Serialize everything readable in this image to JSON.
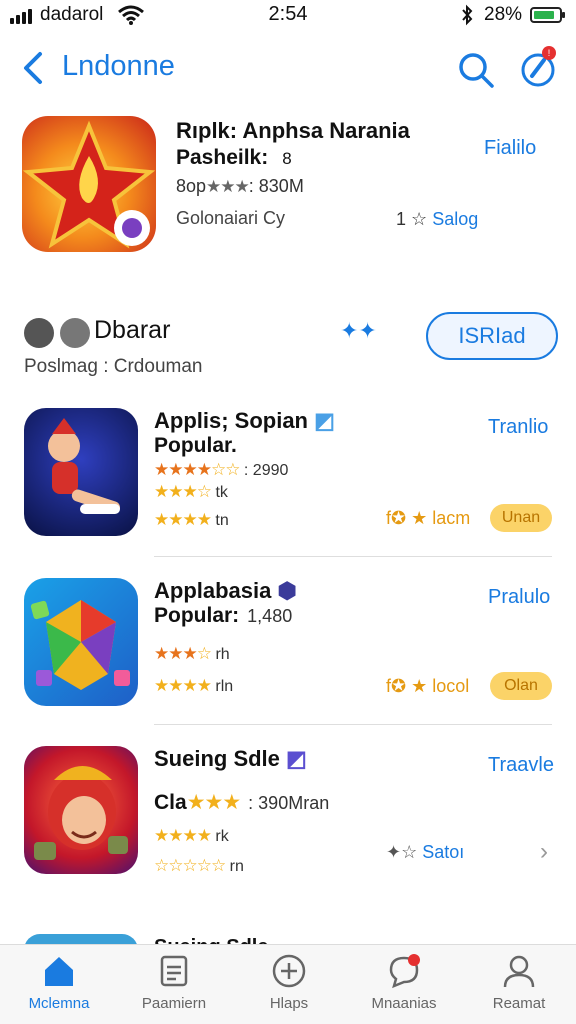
{
  "status_bar": {
    "carrier": "dadarol",
    "time": "2:54",
    "battery": "28%"
  },
  "nav": {
    "title": "Lndonne"
  },
  "featured": {
    "title": "Rıplk: Anphsa Narania",
    "sub_bold": "Pasheilk:",
    "sub_num": "8",
    "rating_prefix": "8op",
    "rating_stars": "★★★",
    "rating_suffix": ": 830M",
    "developer": "Golonaiari Cy",
    "count_num": "1",
    "count_star": "☆",
    "count_label": "Salog",
    "action": "Fialilo"
  },
  "section": {
    "title": "Dbarar",
    "subtitle": "Poslmag : Crdouman",
    "button": "ISRIad"
  },
  "apps": [
    {
      "title": "Applis; Sopian",
      "line2": "Popular.",
      "line2_extra": "",
      "r1_stars": "★★★★",
      "r1_empty": "☆☆",
      "r1_text": ": 2990",
      "r2_stars": "★★★",
      "r2_empty": "☆",
      "r2_text": "tk",
      "r3_stars": "★★★★",
      "r3_empty": "",
      "r3_text": "tn",
      "tag": "f✪ ★ lacm",
      "pill": "Unan",
      "action": "Tranlio"
    },
    {
      "title": "Applabasia",
      "line2": "Popular:",
      "line2_extra": "1,480",
      "r1_stars": "★★★",
      "r1_empty": "☆",
      "r1_text": "rh",
      "r2_stars": "★★★★",
      "r2_empty": "",
      "r2_text": "rln",
      "tag": "f✪ ★ locol",
      "pill": "Olan",
      "action": "Pralulo"
    },
    {
      "title": "Sueing Sdle",
      "line2": "Cla",
      "line2_stars": "★★★",
      "line2_extra": ": 390Mran",
      "r1_stars": "★★★★",
      "r1_empty": "",
      "r1_text": "rk",
      "r2_stars": "",
      "r2_empty": "☆☆☆☆☆",
      "r2_text": "rn",
      "tag_icon": "✦☆",
      "tag": "Satoı",
      "action": "Traavle"
    }
  ],
  "peek": {
    "title": "Sueing Sdle"
  },
  "tabs": [
    {
      "label": "Mclemna",
      "icon": "home-icon"
    },
    {
      "label": "Paamiern",
      "icon": "document-icon"
    },
    {
      "label": "Hlaps",
      "icon": "plus-circle-icon"
    },
    {
      "label": "Mnaanias",
      "icon": "chat-icon"
    },
    {
      "label": "Reamat",
      "icon": "person-icon"
    }
  ],
  "colors": {
    "accent": "#1a7be0",
    "star": "#f2b01c",
    "pill": "#fbd368",
    "badge": "#e53030"
  }
}
